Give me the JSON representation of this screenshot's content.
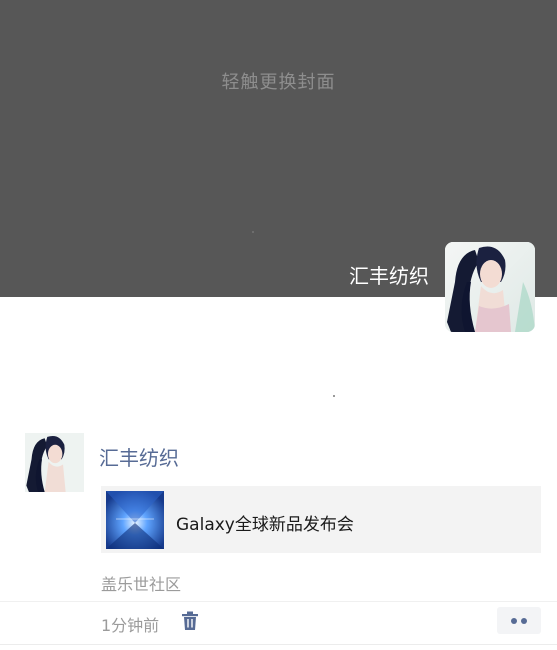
{
  "cover": {
    "hint": "轻触更换封面",
    "background_color": "#575757"
  },
  "profile": {
    "name": "汇丰纺织",
    "avatar_icon": "woman-portrait-avatar"
  },
  "post": {
    "author": "汇丰纺织",
    "author_color": "#576b95",
    "avatar_icon": "woman-portrait-avatar",
    "link": {
      "title": "Galaxy全球新品发布会",
      "thumbnail_icon": "galaxy-event-thumbnail"
    },
    "location": "盖乐世社区",
    "time": "1分钟前",
    "delete_icon": "trash-icon",
    "more_icon": "more-dots-icon"
  }
}
